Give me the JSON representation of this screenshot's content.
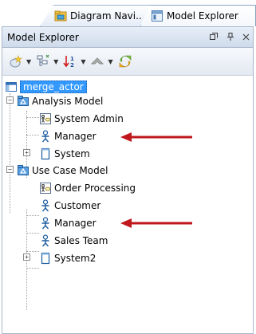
{
  "tabs": [
    {
      "label": "Diagram Navi..",
      "icon": "diagram-navigator-icon",
      "active": false
    },
    {
      "label": "Model Explorer",
      "icon": "model-explorer-icon",
      "active": true
    }
  ],
  "panel": {
    "title": "Model Explorer",
    "header_buttons": [
      "restore-icon",
      "pin-icon",
      "close-icon"
    ]
  },
  "toolbar": {
    "buttons": [
      "new-model-icon",
      "filter-tree-icon",
      "sort-icon",
      "navigate-up-icon",
      "refresh-icon"
    ]
  },
  "tree": {
    "root": "merge_actor",
    "models": [
      {
        "label": "Analysis Model",
        "children": [
          {
            "label": "System Admin",
            "type": "diagram"
          },
          {
            "label": "Manager",
            "type": "actor"
          },
          {
            "label": "System",
            "type": "system"
          }
        ]
      },
      {
        "label": "Use Case Model",
        "children": [
          {
            "label": "Order Processing",
            "type": "diagram"
          },
          {
            "label": "Customer",
            "type": "actor"
          },
          {
            "label": "Manager",
            "type": "actor"
          },
          {
            "label": "Sales Team",
            "type": "actor"
          },
          {
            "label": "System2",
            "type": "system"
          }
        ]
      }
    ]
  },
  "colors": {
    "selection": "#3399ff",
    "arrow": "#c0171d",
    "panel_header": "#dbe5f1",
    "tab_border": "#9fb3cc"
  }
}
